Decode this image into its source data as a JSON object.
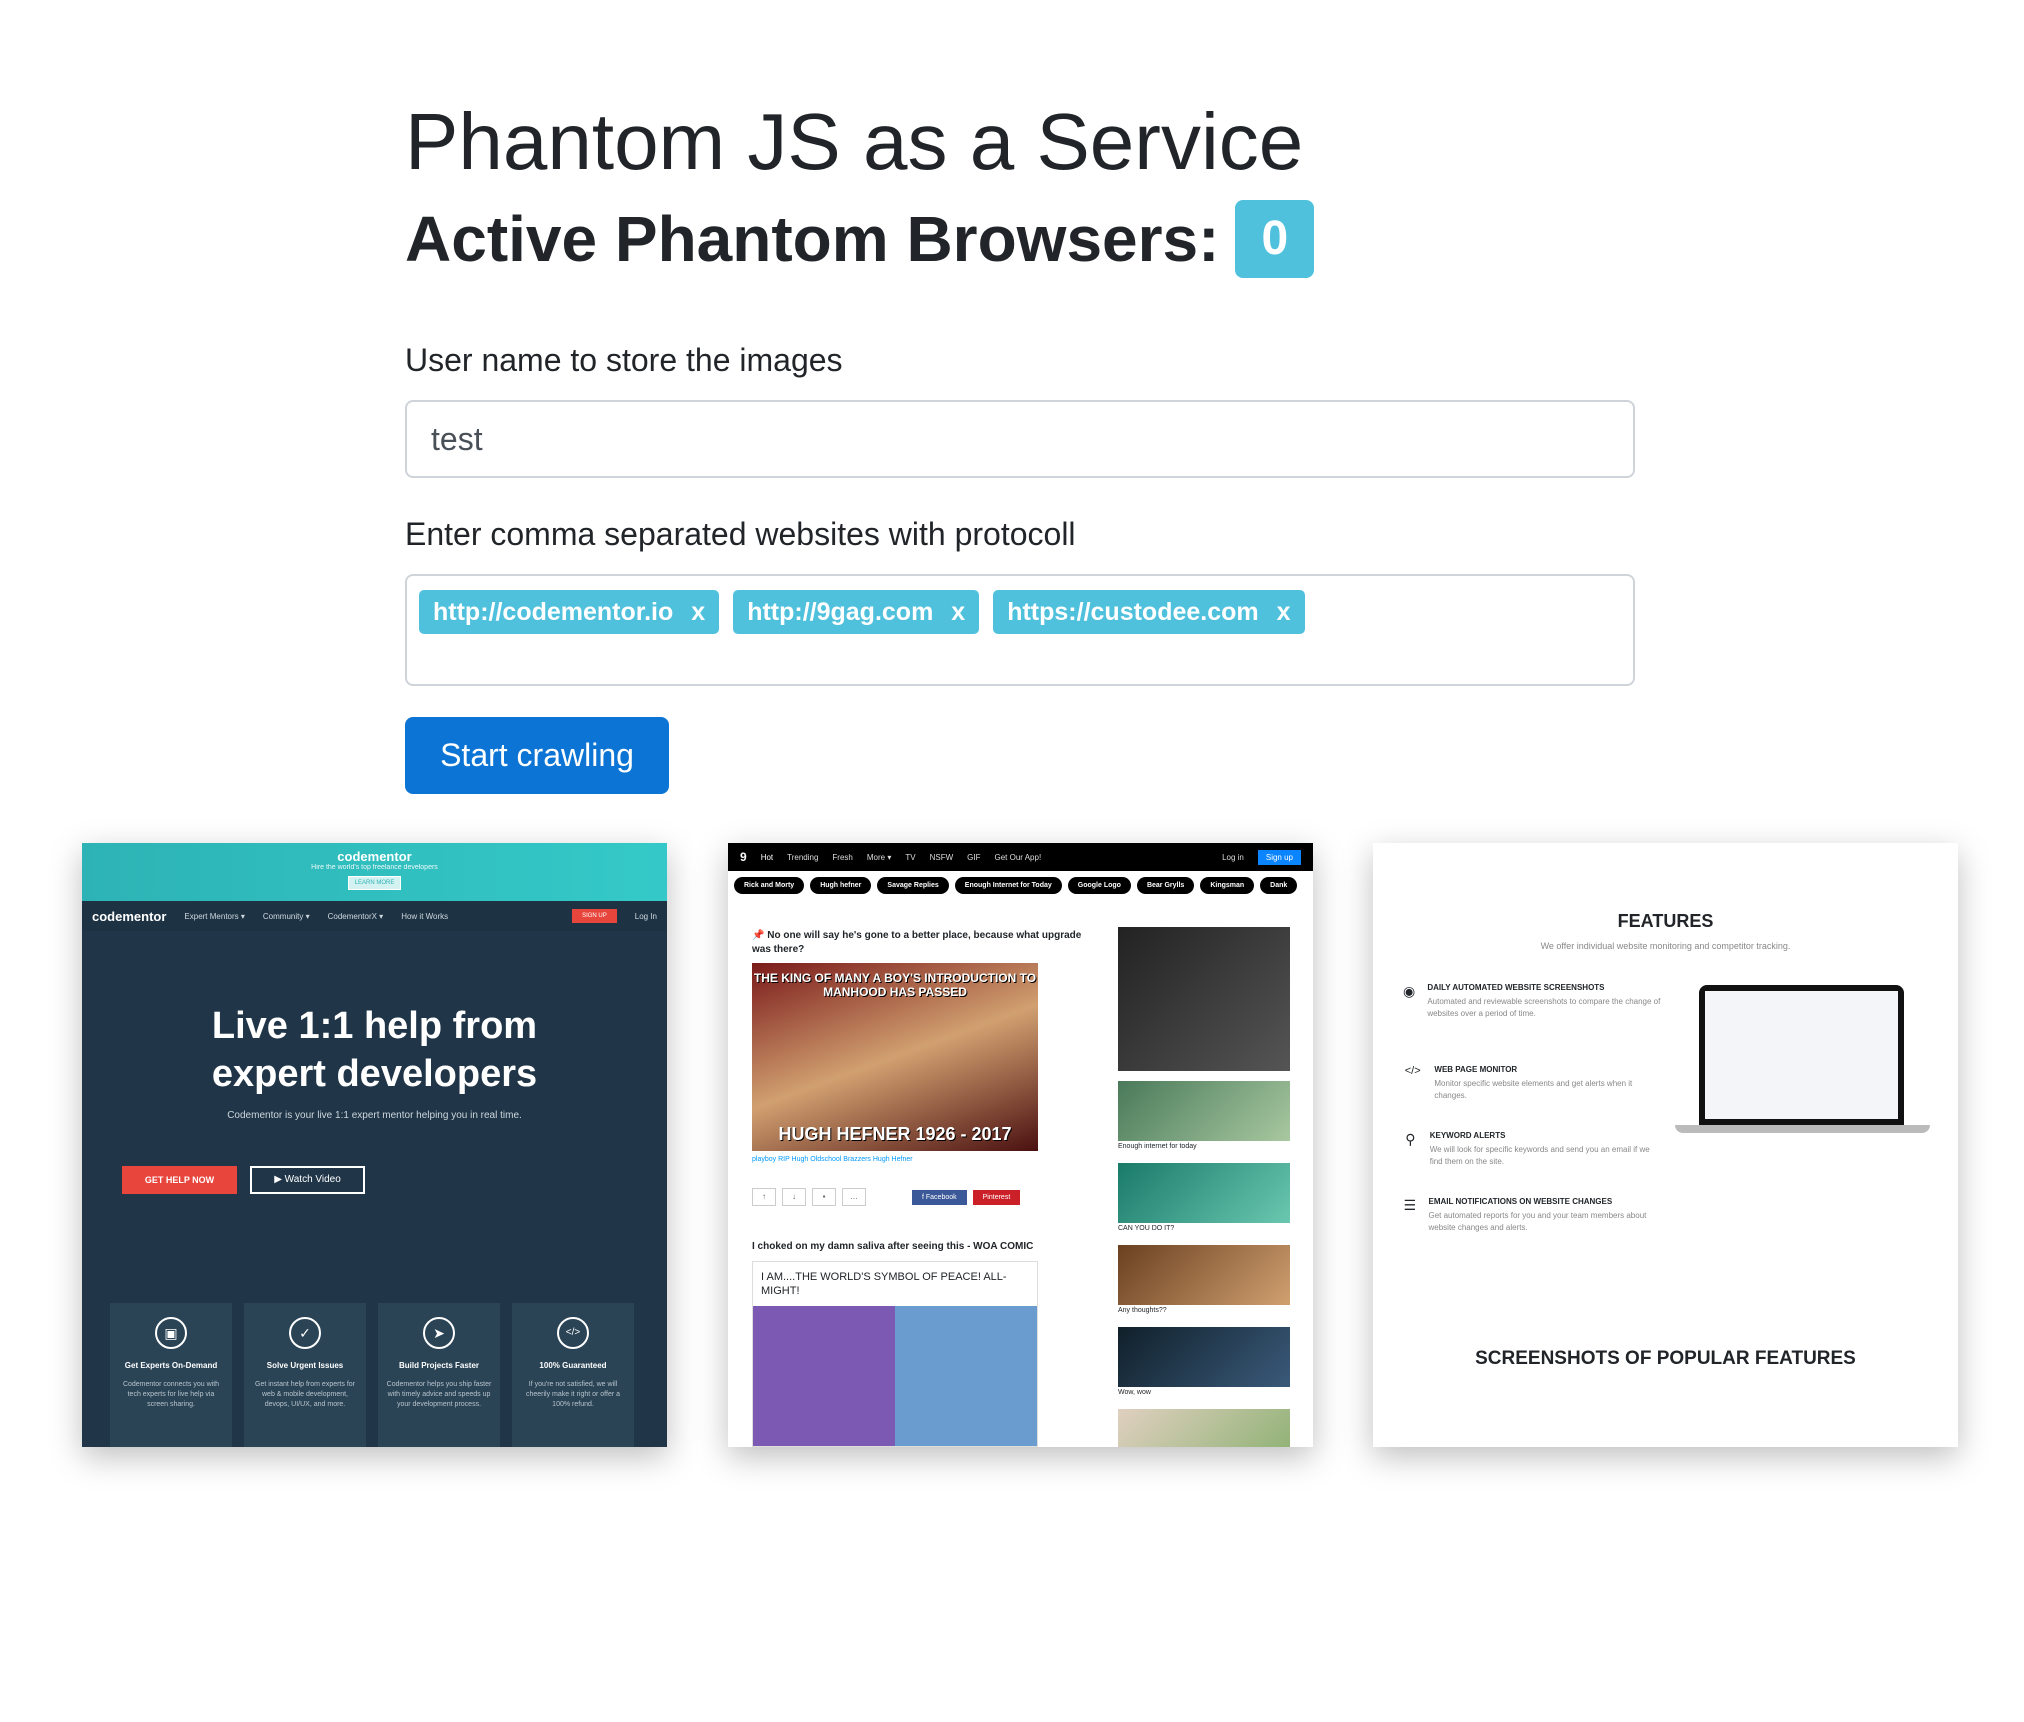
{
  "page": {
    "title": "Phantom JS as a Service",
    "subtitle": "Active Phantom Browsers:",
    "active_count": "0"
  },
  "form": {
    "username_label": "User name to store the images",
    "username_value": "test",
    "websites_label": "Enter comma separated websites with protocoll",
    "tags": [
      {
        "label": "http://codementor.io",
        "remove": "x"
      },
      {
        "label": "http://9gag.com",
        "remove": "x"
      },
      {
        "label": "https://custodee.com",
        "remove": "x"
      }
    ],
    "submit_label": "Start crawling"
  },
  "screenshots": {
    "codementor": {
      "banner_logo": "codementor",
      "banner_tag": "Hire the world's top freelance developers",
      "banner_btn": "LEARN MORE",
      "nav_logo": "codementor",
      "nav_items": [
        "Expert Mentors ▾",
        "Community ▾",
        "CodementorX ▾",
        "How it Works"
      ],
      "nav_signup": "SIGN UP",
      "nav_login": "Log In",
      "hero_title": "Live 1:1 help from expert developers",
      "hero_text": "Codementor is your live 1:1 expert mentor helping you in real time.",
      "cta": "GET HELP NOW",
      "watch": "▶  Watch Video",
      "features": [
        {
          "icon": "▣",
          "title": "Get Experts On-Demand",
          "desc": "Codementor connects you with tech experts for live help via screen sharing."
        },
        {
          "icon": "✓",
          "title": "Solve Urgent Issues",
          "desc": "Get instant help from experts for web & mobile development, devops, UI/UX, and more."
        },
        {
          "icon": "➤",
          "title": "Build Projects Faster",
          "desc": "Codementor helps you ship faster with timely advice and speeds up your development process."
        },
        {
          "icon": "</>",
          "title": "100% Guaranteed",
          "desc": "If you're not satisfied, we will cheerily make it right or offer a 100% refund."
        }
      ]
    },
    "ninegag": {
      "nav": [
        "Hot",
        "Trending",
        "Fresh",
        "More ▾",
        "TV",
        "NSFW",
        "GIF",
        "Get Our App!"
      ],
      "login": "Log in",
      "signup": "Sign up",
      "pills": [
        "Rick and Morty",
        "Hugh hefner",
        "Savage Replies",
        "Enough Internet for Today",
        "Google Logo",
        "Bear Grylls",
        "Kingsman",
        "Dank"
      ],
      "post1_title": "📌 No one will say he's gone to a better place, because what upgrade was there?",
      "post1_top": "THE KING OF MANY A BOY'S INTRODUCTION TO MANHOOD HAS PASSED",
      "post1_bottom": "HUGH HEFNER 1926 - 2017",
      "post1_tags": "playboy  RIP Hugh  Oldschool Brazzers  Hugh Hefner",
      "facebook": "f  Facebook",
      "pinterest": "Pinterest",
      "post2_title": "I choked on my damn saliva after seeing this - WOA COMIC",
      "post2_caption": "I AM....THE WORLD'S SYMBOL OF PEACE! ALL-MIGHT!",
      "side": [
        "Enough internet for today",
        "CAN YOU DO IT?",
        "Any thoughts??",
        "Wow, wow"
      ]
    },
    "custodee": {
      "heading": "FEATURES",
      "sub": "We offer individual website monitoring and competitor tracking.",
      "items": [
        {
          "icon": "◉",
          "title": "DAILY AUTOMATED WEBSITE SCREENSHOTS",
          "desc": "Automated and reviewable screenshots to compare the change of websites over a period of time."
        },
        {
          "icon": "</>",
          "title": "WEB PAGE MONITOR",
          "desc": "Monitor specific website elements and get alerts when it changes."
        },
        {
          "icon": "⚲",
          "title": "KEYWORD ALERTS",
          "desc": "We will look for specific keywords and send you an email if we find them on the site."
        },
        {
          "icon": "☰",
          "title": "EMAIL NOTIFICATIONS ON WEBSITE CHANGES",
          "desc": "Get automated reports for you and your team members about website changes and alerts."
        }
      ],
      "footer": "SCREENSHOTS OF POPULAR FEATURES"
    }
  }
}
